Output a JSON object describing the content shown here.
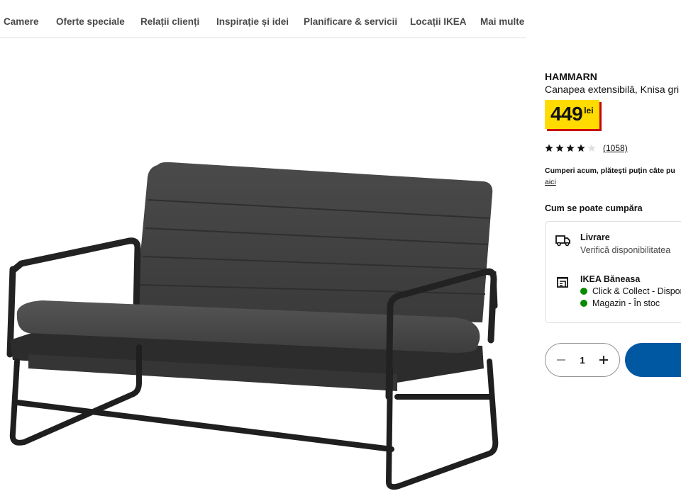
{
  "nav": {
    "items": [
      {
        "label": "Camere"
      },
      {
        "label": "Oferte speciale"
      },
      {
        "label": "Relații clienți"
      },
      {
        "label": "Inspirație și idei"
      },
      {
        "label": "Planificare & servicii"
      },
      {
        "label": "Locații IKEA"
      },
      {
        "label": "Mai multe"
      }
    ]
  },
  "product": {
    "name": "HAMMARN",
    "description": "Canapea extensibilă, Knisa gri",
    "price": "449",
    "currency": "lei",
    "rating_stars": 4,
    "rating_max": 5,
    "review_count": "(1058)",
    "installment_text": "Cumperi acum, plătești puțin câte pu",
    "installment_link": "aici"
  },
  "purchase": {
    "heading": "Cum se poate cumpăra",
    "delivery": {
      "title": "Livrare",
      "subtitle": "Verifică disponibilitatea"
    },
    "store": {
      "title": "IKEA Băneasa",
      "click_collect": "Click & Collect - Dispon",
      "in_store": "Magazin - În stoc"
    },
    "quantity": "1"
  },
  "colors": {
    "price_yellow": "#ffdb00",
    "price_shadow": "#cc0008",
    "brand_blue": "#0058a3",
    "stock_green": "#0a8a00"
  }
}
